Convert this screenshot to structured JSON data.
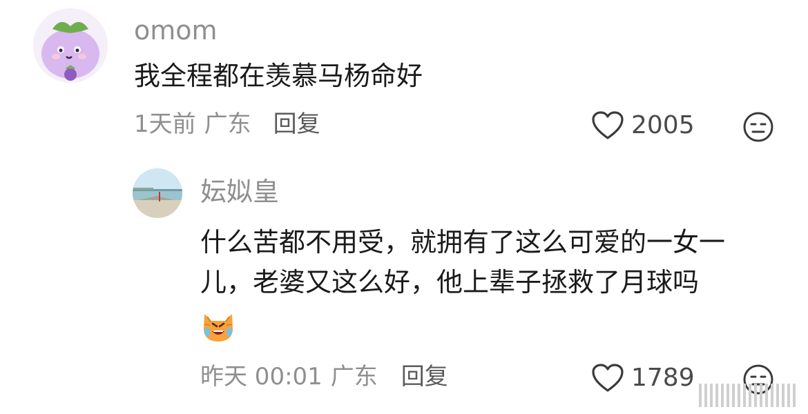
{
  "comments": [
    {
      "username": "omom",
      "text": "我全程都在羡慕马杨命好",
      "time": "1天前",
      "location": "广东",
      "reply_label": "回复",
      "likes": "2005"
    },
    {
      "username": "妘姒皇",
      "text_line1": "什么苦都不用受，就拥有了这么可爱的一女一",
      "text_line2": "儿，老婆又这么好，他上辈子拯救了月球吗",
      "emoji": "cry-laugh-cat",
      "time": "昨天 00:01",
      "location": "广东",
      "reply_label": "回复",
      "likes": "1789"
    }
  ],
  "icons": {
    "like": "heart-outline-icon",
    "dislike": "meh-face-icon"
  },
  "colors": {
    "username": "#8f8f8f",
    "text": "#1a1a1a",
    "meta": "#8f8f8f",
    "icon": "#3a3a3a"
  }
}
